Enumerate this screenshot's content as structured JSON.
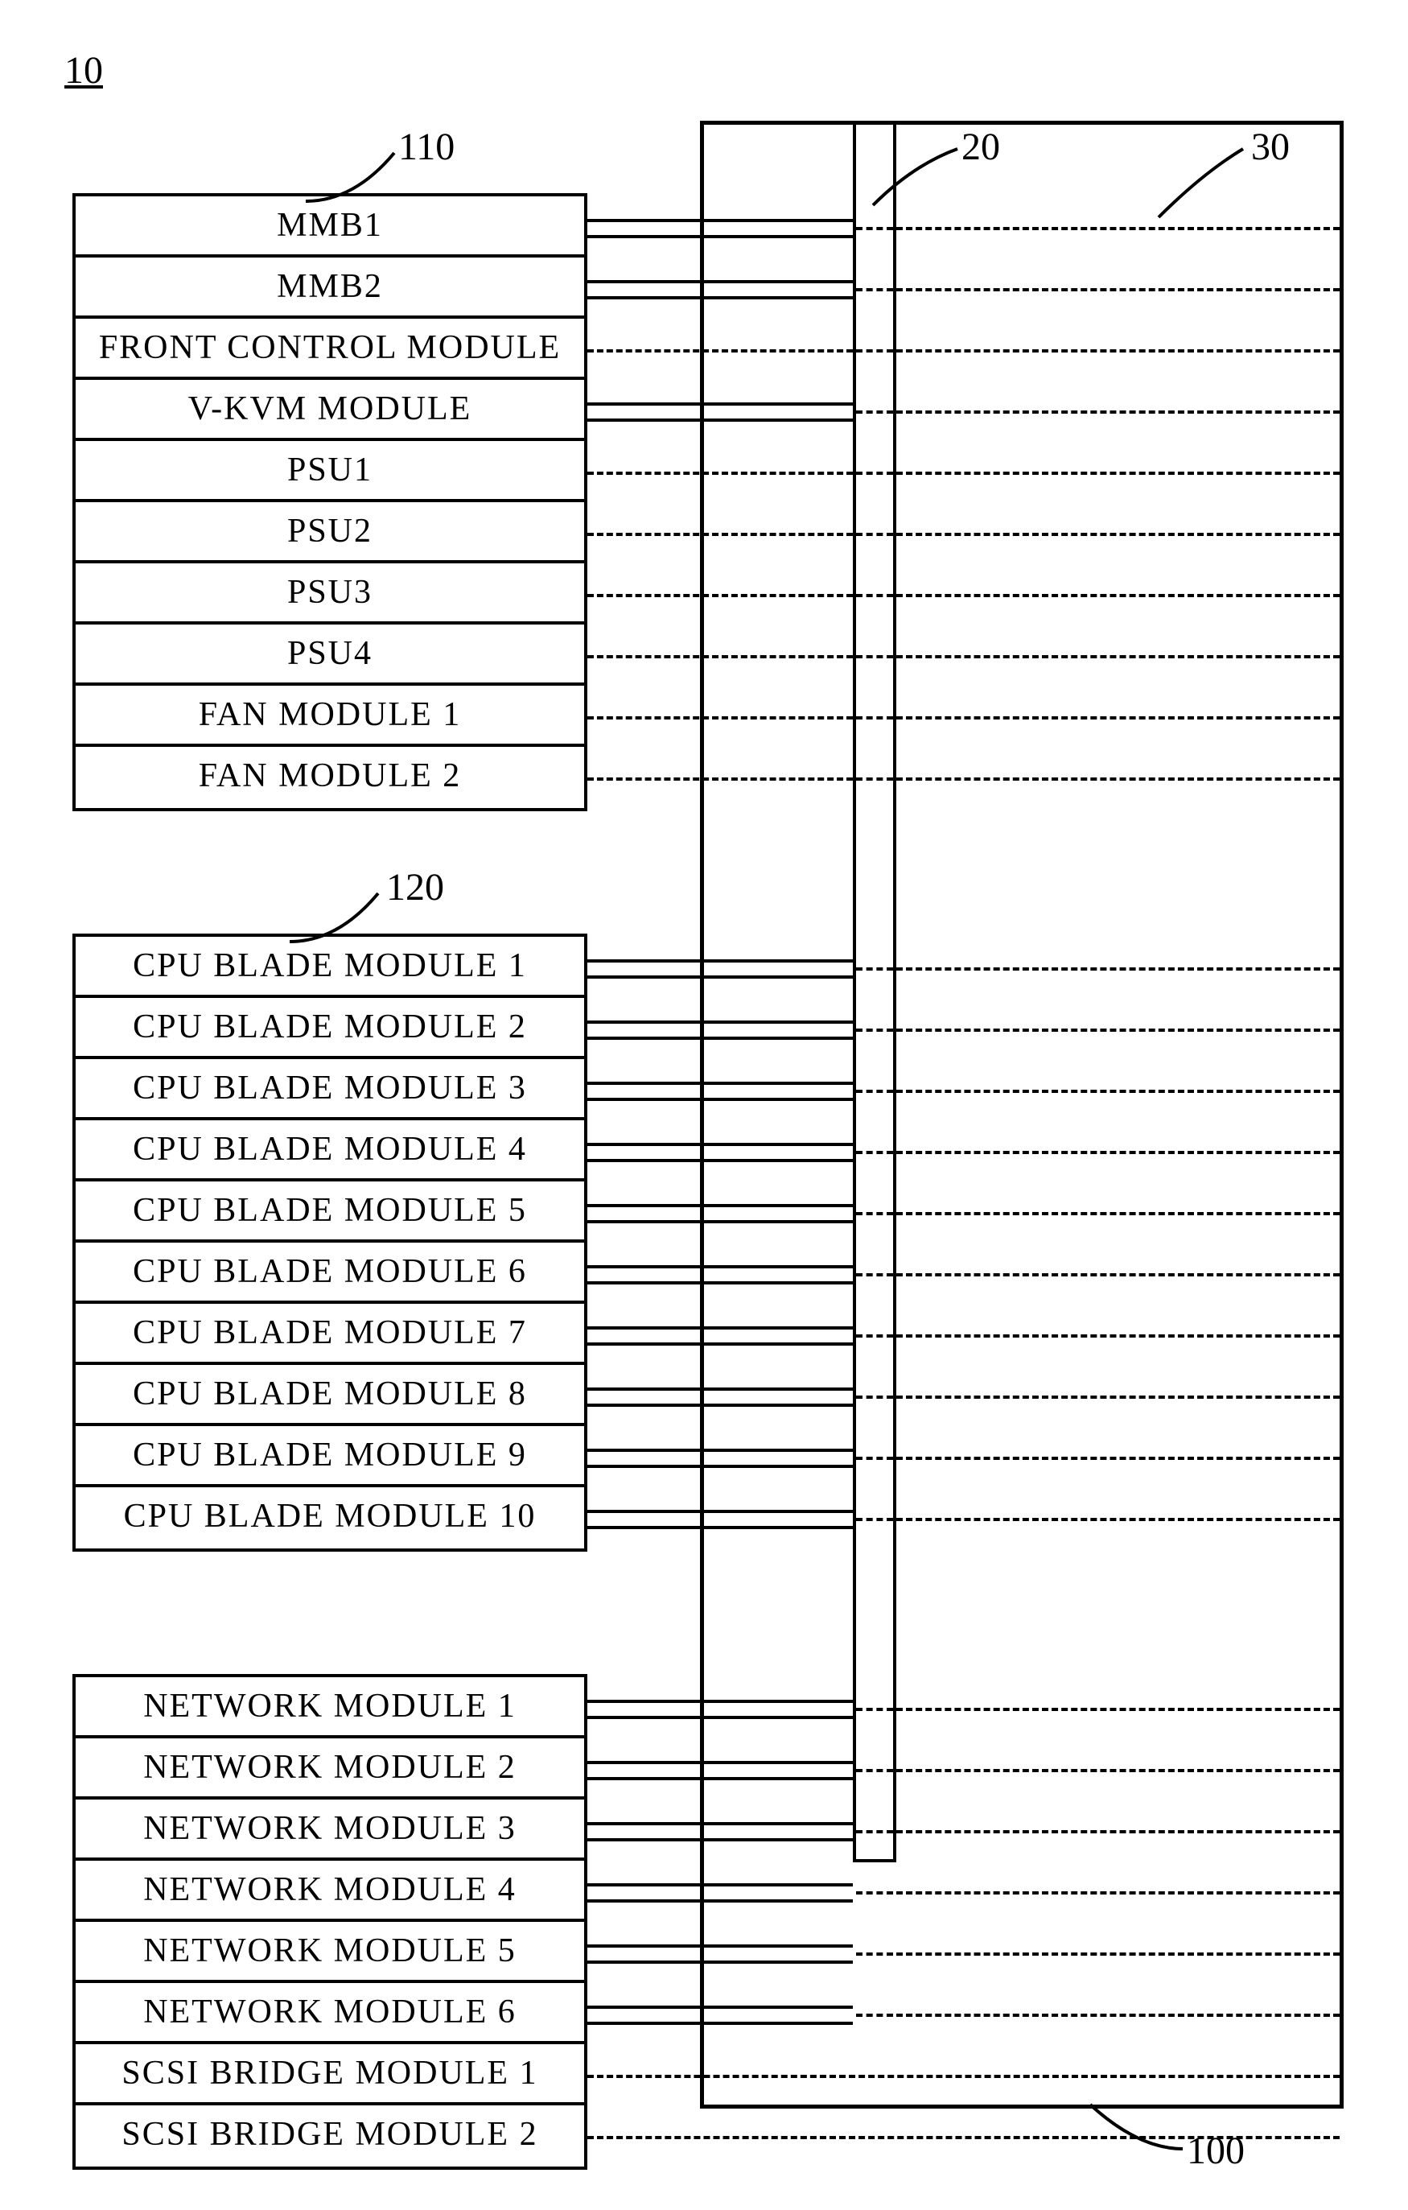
{
  "fig_label": "10",
  "refs": {
    "g1": "110",
    "g2": "120",
    "bus": "20",
    "box": "30",
    "boxbot": "100"
  },
  "group1": [
    "MMB1",
    "MMB2",
    "FRONT CONTROL MODULE",
    "V-KVM MODULE",
    "PSU1",
    "PSU2",
    "PSU3",
    "PSU4",
    "FAN MODULE 1",
    "FAN MODULE 2"
  ],
  "group2": [
    "CPU BLADE MODULE 1",
    "CPU BLADE MODULE 2",
    "CPU BLADE MODULE 3",
    "CPU BLADE MODULE 4",
    "CPU BLADE MODULE 5",
    "CPU BLADE MODULE 6",
    "CPU BLADE MODULE 7",
    "CPU BLADE MODULE 8",
    "CPU BLADE MODULE 9",
    "CPU BLADE MODULE 10"
  ],
  "group3": [
    "NETWORK MODULE 1",
    "NETWORK MODULE 2",
    "NETWORK MODULE 3",
    "NETWORK MODULE 4",
    "NETWORK MODULE 5",
    "NETWORK MODULE 6",
    "SCSI BRIDGE MODULE 1",
    "SCSI BRIDGE MODULE 2"
  ],
  "connections": {
    "group1_solid_pair_to_bus": [
      0,
      1,
      3
    ],
    "group1_dashed_to_bus": [
      2,
      4,
      5,
      6,
      7,
      8,
      9
    ],
    "group1_dashed_to_box": [
      0,
      1,
      2,
      3,
      4,
      5,
      6,
      7,
      8,
      9
    ],
    "group2_solid_pair_to_bus": [
      0,
      1,
      2,
      3,
      4,
      5,
      6,
      7,
      8,
      9
    ],
    "group2_dashed_to_box": [
      0,
      1,
      2,
      3,
      4,
      5,
      6,
      7,
      8,
      9
    ],
    "group3_solid_pair_to_bus": [
      0,
      1,
      2,
      3,
      4,
      5
    ],
    "group3_dashed_to_box": [
      0,
      1,
      2,
      3,
      4,
      5,
      6,
      7
    ]
  }
}
